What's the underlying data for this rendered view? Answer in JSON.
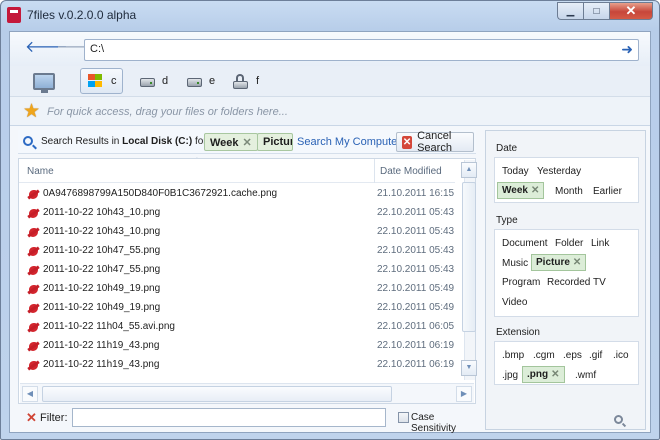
{
  "window": {
    "title": "7files v.0.2.0.0 alpha"
  },
  "nav": {
    "address": "C:\\"
  },
  "drives": [
    {
      "letter": "c"
    },
    {
      "letter": "d"
    },
    {
      "letter": "e"
    },
    {
      "letter": "f"
    }
  ],
  "quick": {
    "hint": "For quick access, drag your files or folders here..."
  },
  "search": {
    "prefix": "Search Results in",
    "location": "Local Disk (C:)",
    "for_word": "for",
    "chips": [
      "Week",
      "Picture"
    ],
    "link": "Search My Computer",
    "cancel": "Cancel Search"
  },
  "columns": {
    "name": "Name",
    "date": "Date Modified"
  },
  "files": [
    {
      "name": "0A9476898799A150D840F0B1C3672921.cache.png",
      "date": "21.10.2011 16:15"
    },
    {
      "name": "2011-10-22 10h43_10.png",
      "date": "22.10.2011 05:43"
    },
    {
      "name": "2011-10-22 10h43_10.png",
      "date": "22.10.2011 05:43"
    },
    {
      "name": "2011-10-22 10h47_55.png",
      "date": "22.10.2011 05:43"
    },
    {
      "name": "2011-10-22 10h47_55.png",
      "date": "22.10.2011 05:43"
    },
    {
      "name": "2011-10-22 10h49_19.png",
      "date": "22.10.2011 05:49"
    },
    {
      "name": "2011-10-22 10h49_19.png",
      "date": "22.10.2011 05:49"
    },
    {
      "name": "2011-10-22 11h04_55.avi.png",
      "date": "22.10.2011 06:05"
    },
    {
      "name": "2011-10-22 11h19_43.png",
      "date": "22.10.2011 06:19"
    },
    {
      "name": "2011-10-22 11h19_43.png",
      "date": "22.10.2011 06:19"
    }
  ],
  "filter": {
    "label": "Filter:",
    "value": "",
    "case_label": "Case Sensitivity"
  },
  "facets": {
    "date": {
      "title": "Date",
      "today": "Today",
      "yesterday": "Yesterday",
      "week": "Week",
      "month": "Month",
      "earlier": "Earlier"
    },
    "type": {
      "title": "Type",
      "document": "Document",
      "folder": "Folder",
      "link": "Link",
      "music": "Music",
      "picture": "Picture",
      "program": "Program",
      "recorded_tv": "Recorded TV",
      "video": "Video"
    },
    "extension": {
      "title": "Extension",
      "bmp": ".bmp",
      "cgm": ".cgm",
      "eps": ".eps",
      "gif": ".gif",
      "ico": ".ico",
      "jpg": ".jpg",
      "png": ".png",
      "wmf": ".wmf"
    }
  },
  "colors": {
    "accent": "#2a62b5",
    "selected_tag_bg": "#dcedd8",
    "file_icon": "#d3262e",
    "cancel_icon": "#d4473a"
  },
  "icons": {
    "app": "7files-app-icon",
    "back": "back-arrow-icon",
    "forward": "forward-arrow-icon",
    "go": "go-arrow-icon",
    "computer": "computer-icon",
    "drive": "hard-drive-icon",
    "star": "star-icon",
    "search": "search-icon",
    "file": "png-file-icon",
    "cancel": "cancel-icon",
    "filter_clear": "clear-filter-icon",
    "facet_search": "magnifier-icon"
  }
}
